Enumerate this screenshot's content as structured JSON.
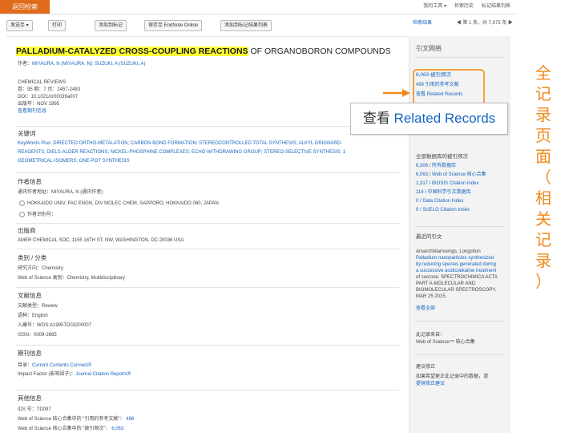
{
  "topbar": {
    "back_label": "返回检索",
    "right_items": [
      "我的工具 ▾",
      "检索历史",
      "标记结果列表"
    ]
  },
  "toolbar": {
    "send_to": "发送至 ▾",
    "print": "打印",
    "add_marked": "添加到标记",
    "endnote": "保存至 EndNote Online",
    "marked_list": "添加到标记结果列表",
    "search_results": "检索结果",
    "record_nav": "◀ 第 1 条，共 7,675 条 ▶"
  },
  "record": {
    "title_highlight": "PALLADIUM-CATALYZED CROSS-COUPLING REACTIONS",
    "title_rest": "OF ORGANOBORON COMPOUNDS",
    "authors_prefix": "作者：",
    "authors": "MIYAURA, N (MIYAURA, N); SUZUKI, A (SUZUKI, A)",
    "journal": "CHEMICAL REVIEWS",
    "volume": "卷：95  期：7  页：2457-2483",
    "doi": "DOI：10.1021/cr00039a007",
    "pubdate": "出版年：NOV 1995",
    "view_journal": "查看期刊信息"
  },
  "keywords": {
    "heading": "关键词",
    "line1": "KeyWords Plus: DIRECTED ORTHO-METALATION; CARBON BOND FORMATION; STEREOCONTROLLED TOTAL SYNTHESIS; ALKYL GRIGNARD-",
    "line2": "REAGENTS; DIELS-ALDER REACTIONS; NICKEL-PHOSPHINE COMPLEXES; ECHO WITHDRAWING GROUP; STEREO-SELECTIVE SYNTHESIS; 1",
    "line3": "GEOMETRICAL-ISOMERS; ONE-POT SYNTHESIS"
  },
  "author_info": {
    "heading": "作者信息",
    "reprint": "通讯作者地址：MIYAURA, N (通讯作者)",
    "address": "HOKKAIDO UNIV, FAC ENGN, DIV MOLEC CHEM, SAPPORO, HOKKAIDO 060, JAPAN.",
    "org": "作者识别号："
  },
  "publisher": {
    "heading": "出版商",
    "text": "AMER CHEMICAL SOC, 1155 16TH ST, NW, WASHINGTON, DC 20036 USA"
  },
  "category": {
    "heading": "类别 / 分类",
    "area": "研究方向：Chemistry",
    "wos": "Web of Science 类别：Chemistry, Multidisciplinary"
  },
  "doc_info": {
    "heading": "文献信息",
    "type": "文献类型：Review",
    "lang": "语种：English",
    "acc": "入藏号：WOS:A1995TD03200007",
    "issn": "ISSN：0009-2665"
  },
  "journal_info": {
    "heading": "期刊信息",
    "contents_prefix": "目录：",
    "contents_link": "Current Contents Connect®",
    "if_prefix": "Impact Factor (影响因子)：",
    "if_link": "Journal Citation Reports®"
  },
  "other_info": {
    "heading": "其他信息",
    "ids": "IDS 号：TD097",
    "refs_label": "Web of Science 核心合集中的 \"引用的参考文献\"：",
    "refs_value": "496",
    "cited_label": "Web of Science 核心合集中的 \"被引频次\"：",
    "cited_value": "6,063"
  },
  "sidebar": {
    "citation_network": "引文网络",
    "times_cited": "6,063 被引频次",
    "cited_refs": "496 引用的参考文献",
    "related": "查看 Related Records",
    "all_db_heading": "全部数据库的被引频次",
    "counts": [
      "6,306 / 所有数据库",
      "6,063 / Web of Science 核心合集",
      "1,317 / BIOSIS Citation Index",
      "116 / 中国科学引文数据库",
      "0 / Data Citation Index",
      "0 / SciELO Citation Index"
    ],
    "recent_heading": "最近的引文",
    "recent_lines": [
      "Amarchhilamsengs, Longshon",
      "Palladium nanoparticles synthesized",
      "by reducing species generated during",
      "a successive acidic/alkaline treatment",
      "of sucrose. SPECTROCHIMICA ACTA",
      "PART A-MOLECULAR AND",
      "BIOMOLECULAR SPECTROSCOPY.",
      "MAR 25 2015."
    ],
    "view_all": "查看全部",
    "record_from_heading": "此记录来自：",
    "record_from": "Web of Science™ 核心合集",
    "suggest_heading": "建议修正",
    "suggest_line1": "如果希望更正此记录中的数据，请",
    "suggest_link": "提供修正建议"
  },
  "annotation": {
    "callout_cn": "查看",
    "callout_en": "Related Records",
    "vertical_chars": [
      "全",
      "记",
      "录",
      "页",
      "面",
      "（",
      "相",
      "关",
      "记",
      "录",
      "）"
    ],
    "accent_color": "#f08a1c"
  }
}
